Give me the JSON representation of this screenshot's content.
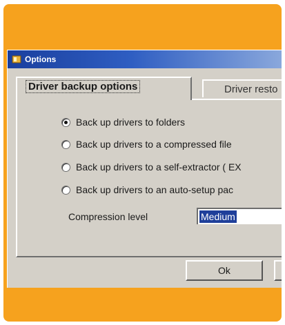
{
  "window": {
    "title": "Options",
    "icon": "app-icon"
  },
  "tabs": [
    {
      "label": "Driver backup options",
      "active": true
    },
    {
      "label": "Driver resto",
      "active": false
    }
  ],
  "options": [
    {
      "label": "Back up drivers to folders",
      "checked": true
    },
    {
      "label": "Back up drivers to a compressed file",
      "checked": false
    },
    {
      "label": "Back up drivers to a self-extractor ( EX",
      "checked": false
    },
    {
      "label": "Back up drivers to an auto-setup pac",
      "checked": false
    }
  ],
  "compression": {
    "label": "Compression level",
    "value": "Medium"
  },
  "buttons": {
    "ok": "Ok",
    "cancel": ""
  },
  "colors": {
    "frame_orange": "#f6a21e",
    "dialog_gray": "#d4d0c8",
    "title_blue": "#1a3f9e",
    "selection_blue": "#1f3f9a"
  }
}
